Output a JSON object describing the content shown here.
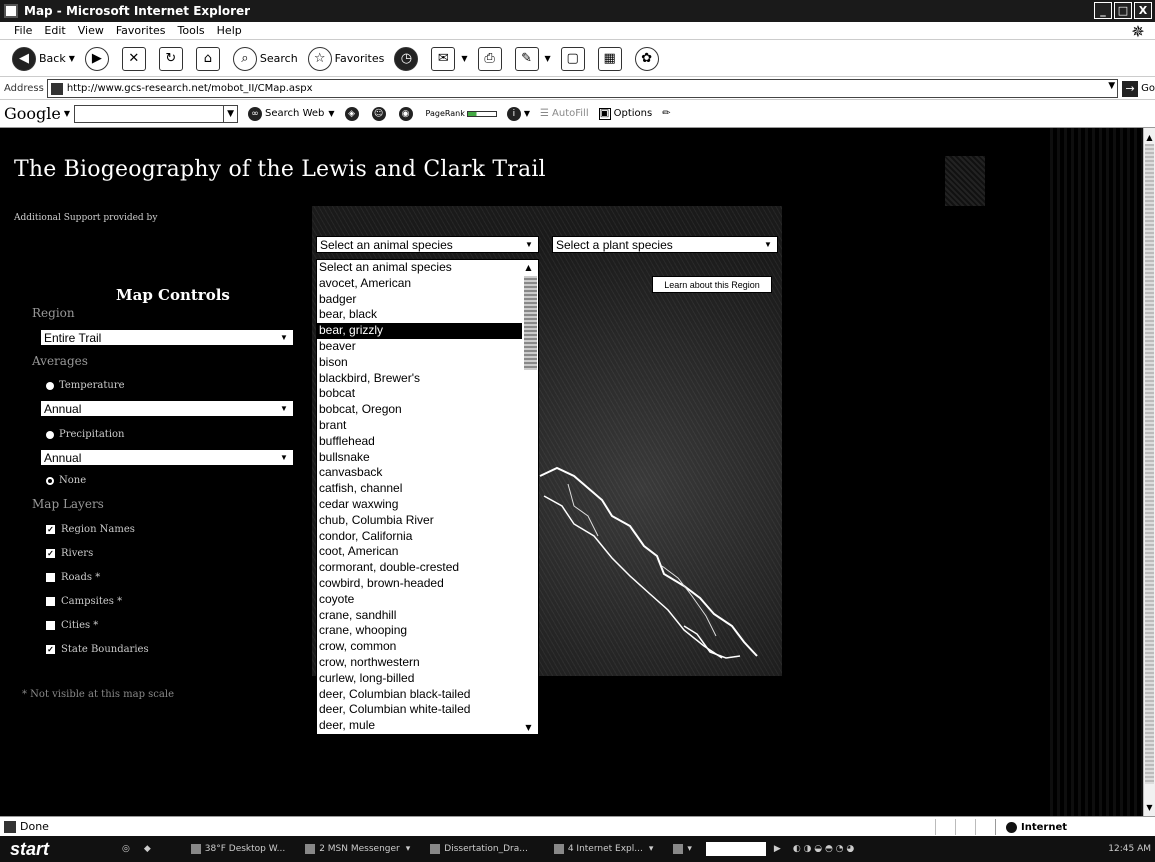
{
  "window": {
    "title": "Map - Microsoft Internet Explorer",
    "buttons": [
      "_",
      "□",
      "X"
    ]
  },
  "menu": [
    "File",
    "Edit",
    "View",
    "Favorites",
    "Tools",
    "Help"
  ],
  "toolbar": {
    "back": "Back",
    "search": "Search",
    "favorites": "Favorites"
  },
  "address": {
    "label": "Address",
    "url": "http://www.gcs-research.net/mobot_II/CMap.aspx",
    "go": "Go"
  },
  "google_bar": {
    "logo": "Google",
    "search_web": "Search Web",
    "pagerank": "PageRank",
    "autofill": "AutoFill",
    "options": "Options"
  },
  "page": {
    "title": "The Biogeography of the Lewis and Clark Trail",
    "support": "Additional Support provided by"
  },
  "controls": {
    "heading": "Map Controls",
    "region_label": "Region",
    "region_value": "Entire Trail",
    "averages_label": "Averages",
    "temperature_label": "Temperature",
    "temperature_value": "Annual",
    "precipitation_label": "Precipitation",
    "precipitation_value": "Annual",
    "none_label": "None",
    "layers_label": "Map Layers",
    "layers": [
      {
        "label": "Region Names",
        "checked": true
      },
      {
        "label": "Rivers",
        "checked": true
      },
      {
        "label": "Roads *",
        "checked": false
      },
      {
        "label": "Campsites *",
        "checked": false
      },
      {
        "label": "Cities *",
        "checked": false
      },
      {
        "label": "State Boundaries",
        "checked": true
      }
    ],
    "footnote": "* Not visible at this map scale"
  },
  "animal_select": {
    "value": "Select an animal species",
    "selected_index": 5,
    "options": [
      "Select an animal species",
      "avocet, American",
      "badger",
      "bear, black",
      "bear, grizzly",
      "beaver",
      "bison",
      "blackbird, Brewer's",
      "bobcat",
      "bobcat, Oregon",
      "brant",
      "bufflehead",
      "bullsnake",
      "canvasback",
      "catfish, channel",
      "cedar waxwing",
      "chub, Columbia River",
      "condor, California",
      "coot, American",
      "cormorant, double-crested",
      "cowbird, brown-headed",
      "coyote",
      "crane, sandhill",
      "crane, whooping",
      "crow, common",
      "crow, northwestern",
      "curlew, long-billed",
      "deer, Columbian black-tailed",
      "deer, Columbian white-tailed",
      "deer, mule"
    ]
  },
  "plant_select": {
    "value": "Select a plant species"
  },
  "learn_button": "Learn about this Region",
  "status": {
    "text": "Done",
    "zone": "Internet"
  },
  "taskbar": {
    "start": "start",
    "tasks": [
      "38°F Desktop W...",
      "2 MSN Messenger",
      "Dissertation_Dra...",
      "4 Internet Expl..."
    ],
    "clock": "12:45 AM"
  }
}
